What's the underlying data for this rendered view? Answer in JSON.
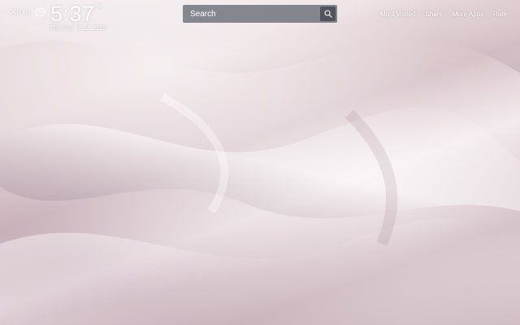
{
  "header": {
    "options_label": "Options",
    "clock_icon": "clock-icon",
    "time": "5:37",
    "ampm": "PM",
    "date": "Monday  3.12.2018"
  },
  "search": {
    "placeholder": "Search",
    "button_icon": "search-icon"
  },
  "nav": {
    "links": [
      {
        "label": "Most Visited"
      },
      {
        "label": "Share"
      },
      {
        "label": "More Apps"
      },
      {
        "label": "Rate"
      }
    ]
  },
  "wallpaper": {
    "description_colors": [
      "#ddcad0",
      "#f1e7ea",
      "#cdb8bf"
    ]
  }
}
